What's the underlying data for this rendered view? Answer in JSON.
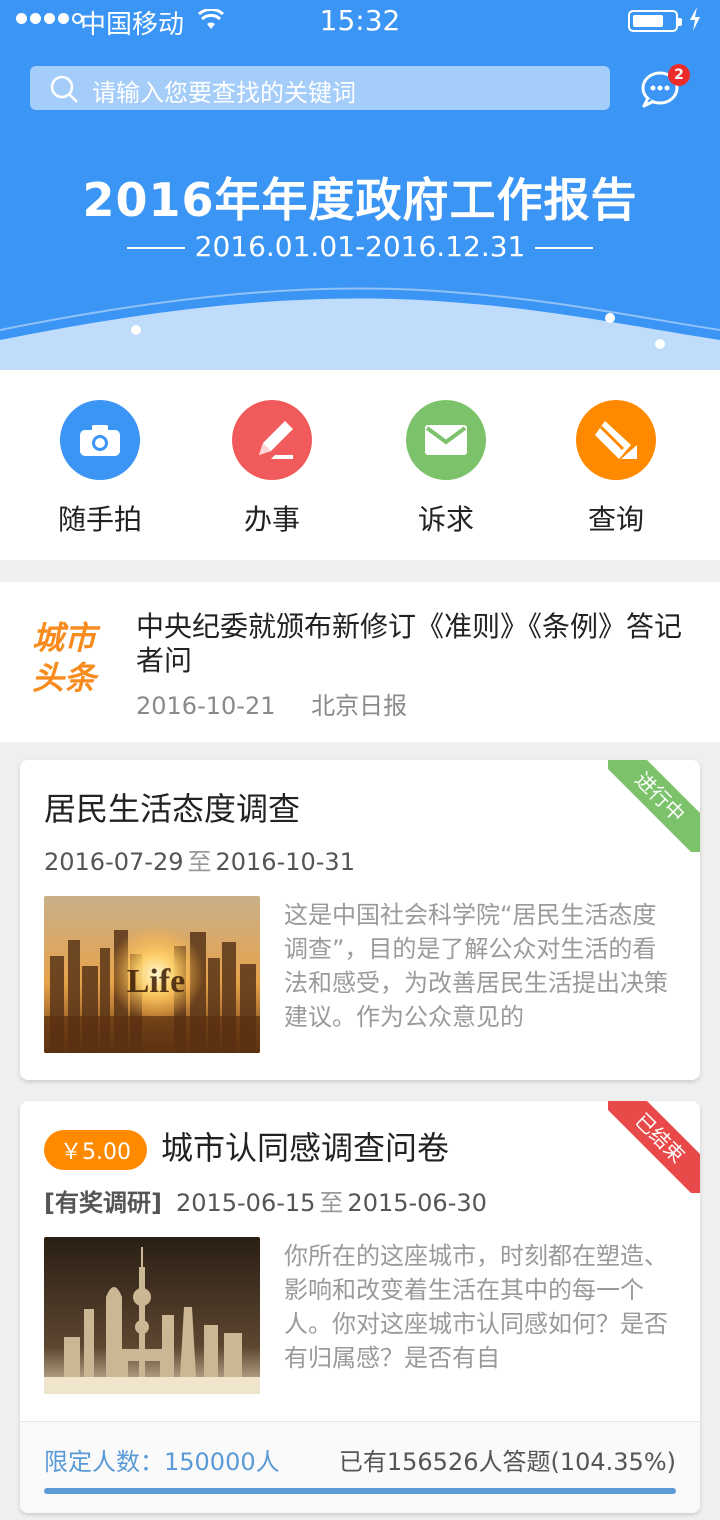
{
  "status_bar": {
    "carrier": "中国移动",
    "time": "15:32"
  },
  "search": {
    "placeholder": "请输入您要查找的关键词"
  },
  "messages": {
    "badge_count": "2"
  },
  "banner": {
    "title": "2016年年度政府工作报告",
    "date_range": "2016.01.01-2016.12.31"
  },
  "quick_actions": [
    {
      "label": "随手拍",
      "icon": "camera-icon",
      "color": "#3b95f5"
    },
    {
      "label": "办事",
      "icon": "pen-icon",
      "color": "#f25b5b"
    },
    {
      "label": "诉求",
      "icon": "envelope-icon",
      "color": "#7cc26b"
    },
    {
      "label": "查询",
      "icon": "clip-icon",
      "color": "#ff8a00"
    }
  ],
  "headline": {
    "logo_line1": "城市",
    "logo_line2": "头条",
    "title": "中央纪委就颁布新修订《准则》《条例》答记者问",
    "date": "2016-10-21",
    "source": "北京日报"
  },
  "surveys": [
    {
      "title": "居民生活态度调查",
      "start": "2016-07-29",
      "to": "至",
      "end": "2016-10-31",
      "status": "进行中",
      "status_color": "#7cc26b",
      "image_text": "Life",
      "description": "这是中国社会科学院“居民生活态度调查”，目的是了解公众对生活的看法和感受，为改善居民生活提出决策建议。作为公众意见的"
    },
    {
      "price": "￥5.00",
      "title": "城市认同感调查问卷",
      "tag": "[有奖调研]",
      "start": "2015-06-15",
      "to": "至",
      "end": "2015-06-30",
      "status": "已结束",
      "status_color": "#e84a4a",
      "description": "你所在的这座城市，时刻都在塑造、影响和改变着生活在其中的每一个人。你对这座城市认同感如何？是否有归属感？是否有自",
      "limit_label": "限定人数：150000人",
      "answered_label": "已有156526人答题(104.35%)",
      "progress": 1.0
    }
  ]
}
